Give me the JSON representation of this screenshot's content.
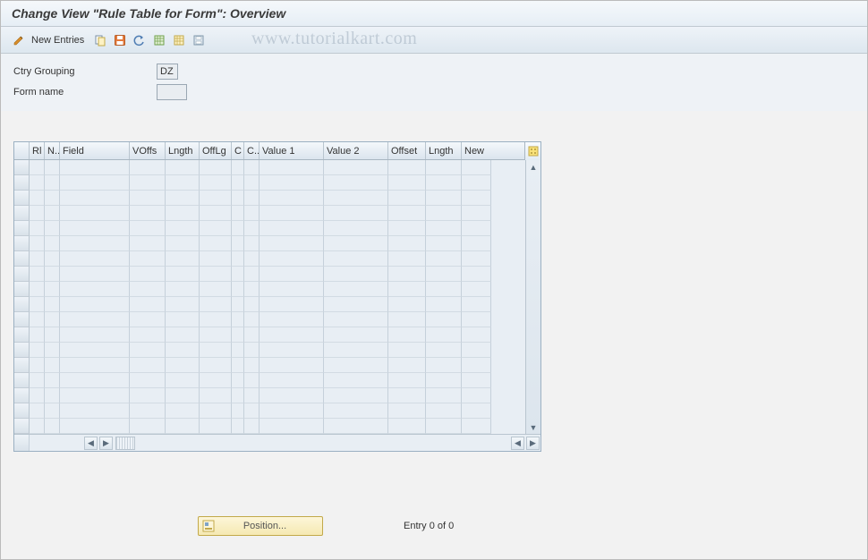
{
  "title": "Change View \"Rule Table for Form\": Overview",
  "watermark": "www.tutorialkart.com",
  "toolbar": {
    "new_entries_label": "New Entries"
  },
  "header": {
    "ctry_grouping_label": "Ctry Grouping",
    "ctry_grouping_value": "DZ",
    "form_name_label": "Form name",
    "form_name_value": ""
  },
  "table": {
    "columns": {
      "rl": "Rl",
      "n": "N..",
      "field": "Field",
      "voffs": "VOffs",
      "lngth": "Lngth",
      "offlg": "OffLg",
      "c1": "C",
      "c2": "C..",
      "value1": "Value 1",
      "value2": "Value 2",
      "offset": "Offset",
      "lngth2": "Lngth",
      "new": "New"
    },
    "rows": []
  },
  "footer": {
    "position_label": "Position...",
    "entry_label": "Entry 0 of 0"
  }
}
